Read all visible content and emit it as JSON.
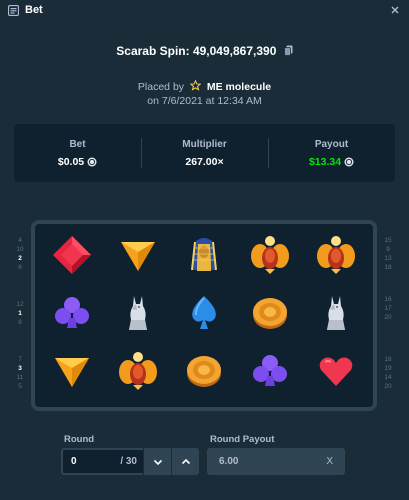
{
  "window": {
    "title": "Bet",
    "title_icon": "bet-list-icon",
    "close_icon": "close-icon"
  },
  "header": {
    "spin_text": "Scarab Spin: 49,049,867,390",
    "placed_by": "Placed by",
    "username": "ME molecule",
    "date": "on 7/6/2021 at 12:34 AM"
  },
  "stats": {
    "bet_label": "Bet",
    "bet_value": "$0.05",
    "multiplier_label": "Multiplier",
    "multiplier_value": "267.00×",
    "payout_label": "Payout",
    "payout_value": "$13.34",
    "payout_color": "#00e701"
  },
  "reels": {
    "rows": [
      [
        "red-gem",
        "orange-triangle",
        "pharaoh",
        "scarab",
        "scarab"
      ],
      [
        "purple-club",
        "anubis-statue",
        "blue-spade",
        "gold-coin",
        "anubis-statue"
      ],
      [
        "orange-triangle",
        "scarab",
        "gold-coin",
        "purple-club",
        "red-heart"
      ]
    ]
  },
  "paylines": {
    "left": [
      {
        "nums": [
          "4",
          "10",
          "2",
          "6"
        ],
        "highlight": "2"
      },
      {
        "nums": [
          "12",
          "1",
          "8"
        ],
        "highlight": "1"
      },
      {
        "nums": [
          "7",
          "3",
          "11",
          "5"
        ],
        "highlight": "3"
      }
    ],
    "right": [
      {
        "nums": [
          "15",
          "9",
          "13",
          "18"
        ],
        "highlight": ""
      },
      {
        "nums": [
          "16",
          "17",
          "20"
        ],
        "highlight": ""
      },
      {
        "nums": [
          "18",
          "19",
          "14",
          "20"
        ],
        "highlight": ""
      }
    ]
  },
  "controls": {
    "round_label": "Round",
    "round_value": "0",
    "round_total": "/ 30",
    "round_payout_label": "Round Payout",
    "round_payout_value": "6.00",
    "clear_label": "X"
  }
}
